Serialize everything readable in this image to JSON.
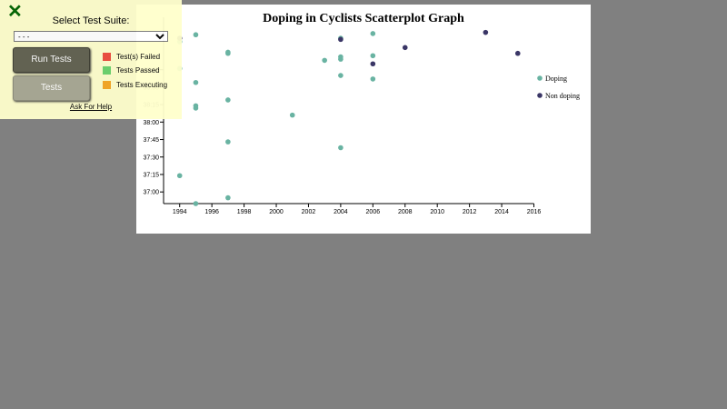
{
  "chart_data": {
    "type": "scatter",
    "title": "Doping in Cyclists Scatterplot Graph",
    "xlabel": "",
    "ylabel": "",
    "xlim": [
      1993,
      2016
    ],
    "x_ticks": [
      1994,
      1996,
      1998,
      2000,
      2002,
      2004,
      2006,
      2008,
      2010,
      2012,
      2014,
      2016
    ],
    "ylim": [
      "36:50",
      "39:30"
    ],
    "y_tick_labels": [
      "37:00",
      "37:15",
      "37:30",
      "37:45",
      "38:00",
      "38:15",
      "38:30",
      "38:45"
    ],
    "y_ticks_seconds": [
      2220,
      2235,
      2250,
      2265,
      2280,
      2295,
      2310,
      2325
    ],
    "y_inverted": true,
    "legend_position": "right",
    "series": [
      {
        "name": "Doping",
        "color": "#69b3a2",
        "points": [
          {
            "x": 1995,
            "y": "36:50"
          },
          {
            "x": 1997,
            "y": "36:55"
          },
          {
            "x": 1994,
            "y": "37:14"
          },
          {
            "x": 1997,
            "y": "37:43"
          },
          {
            "x": 2004,
            "y": "37:38"
          },
          {
            "x": 2001,
            "y": "38:06"
          },
          {
            "x": 1995,
            "y": "38:12"
          },
          {
            "x": 1995,
            "y": "38:14"
          },
          {
            "x": 1997,
            "y": "38:19"
          },
          {
            "x": 1995,
            "y": "38:34"
          },
          {
            "x": 2006,
            "y": "38:37"
          },
          {
            "x": 2004,
            "y": "38:40"
          },
          {
            "x": 1994,
            "y": "38:46"
          },
          {
            "x": 2003,
            "y": "38:53"
          },
          {
            "x": 2004,
            "y": "38:54"
          },
          {
            "x": 2004,
            "y": "38:56"
          },
          {
            "x": 2006,
            "y": "38:57"
          },
          {
            "x": 1997,
            "y": "38:59"
          },
          {
            "x": 1997,
            "y": "39:00"
          },
          {
            "x": 1994,
            "y": "39:09"
          },
          {
            "x": 1995,
            "y": "39:15"
          },
          {
            "x": 2004,
            "y": "39:12"
          },
          {
            "x": 2006,
            "y": "39:16"
          }
        ]
      },
      {
        "name": "Non doping",
        "color": "#3a3666",
        "points": [
          {
            "x": 2006,
            "y": "38:50"
          },
          {
            "x": 2015,
            "y": "38:59"
          },
          {
            "x": 2008,
            "y": "39:04"
          },
          {
            "x": 2004,
            "y": "39:11"
          },
          {
            "x": 2013,
            "y": "39:17"
          },
          {
            "x": 1994,
            "y": "39:12"
          }
        ]
      }
    ]
  },
  "panel": {
    "title": "Select Test Suite:",
    "select_value": "- - -",
    "run_tests_label": "Run Tests",
    "tests_label": "Tests",
    "status_failed": "Test(s) Failed",
    "status_passed": "Tests Passed",
    "status_executing": "Tests Executing",
    "help_link": "Ask For Help",
    "close_icon": "close-x-icon",
    "colors": {
      "failed": "#ee4b3b",
      "passed": "#6ad36b",
      "executing": "#f5a623"
    }
  }
}
